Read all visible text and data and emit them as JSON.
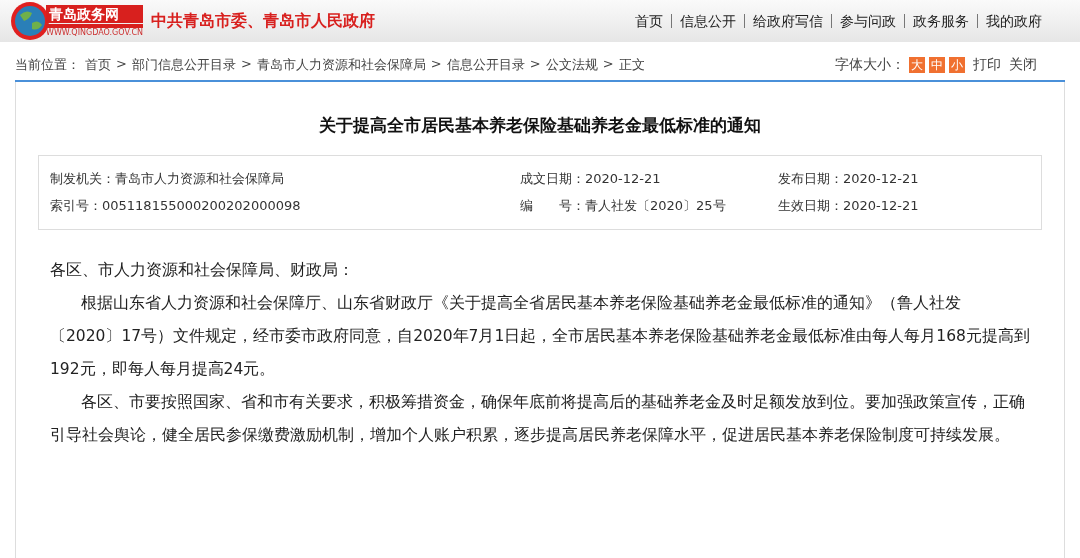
{
  "header": {
    "logo_text": "青岛政务网",
    "logo_url": "WWW.QINGDAO.GOV.CN",
    "site_title": "中共青岛市委、青岛市人民政府",
    "nav": [
      "首页",
      "信息公开",
      "给政府写信",
      "参与问政",
      "政务服务",
      "我的政府"
    ]
  },
  "breadcrumb": {
    "label": "当前位置：",
    "items": [
      {
        "text": "首页"
      },
      {
        "sep": ">",
        "text": "部门信息公开目录"
      },
      {
        "sep": ">",
        "text": "青岛市人力资源和社会保障局"
      },
      {
        "sep": ">",
        "text": "信息公开目录"
      },
      {
        "sep": ">",
        "text": "公文法规"
      },
      {
        "sep": ">",
        "text": "正文"
      }
    ]
  },
  "tools": {
    "font_size_label": "字体大小：",
    "sizes": [
      "大",
      "中",
      "小"
    ],
    "links": [
      "打印",
      "关闭"
    ]
  },
  "article": {
    "title": "关于提高全市居民基本养老保险基础养老金最低标准的通知",
    "meta": [
      {
        "label": "制发机关：",
        "value": "青岛市人力资源和社会保障局"
      },
      {
        "label": "成文日期：",
        "value": "2020-12-21"
      },
      {
        "label": "发布日期：",
        "value": "2020-12-21"
      },
      {
        "label": "索引号：",
        "value": "005118155000200202000098"
      },
      {
        "label": "编　　号：",
        "value": "青人社发〔2020〕25号"
      },
      {
        "label": "生效日期：",
        "value": "2020-12-21"
      }
    ],
    "paragraphs": [
      {
        "kind": "salutation",
        "text": "各区、市人力资源和社会保障局、财政局："
      },
      {
        "kind": "body",
        "text": "根据山东省人力资源和社会保障厅、山东省财政厅《关于提高全省居民基本养老保险基础养老金最低标准的通知》（鲁人社发〔2020〕17号）文件规定，经市委市政府同意，自2020年7月1日起，全市居民基本养老保险基础养老金最低标准由每人每月168元提高到192元，即每人每月提高24元。"
      },
      {
        "kind": "body",
        "text": "各区、市要按照国家、省和市有关要求，积极筹措资金，确保年底前将提高后的基础养老金及时足额发放到位。要加强政策宣传，正确引导社会舆论，健全居民参保缴费激励机制，增加个人账户积累，逐步提高居民养老保障水平，促进居民基本养老保险制度可持续发展。"
      }
    ]
  }
}
